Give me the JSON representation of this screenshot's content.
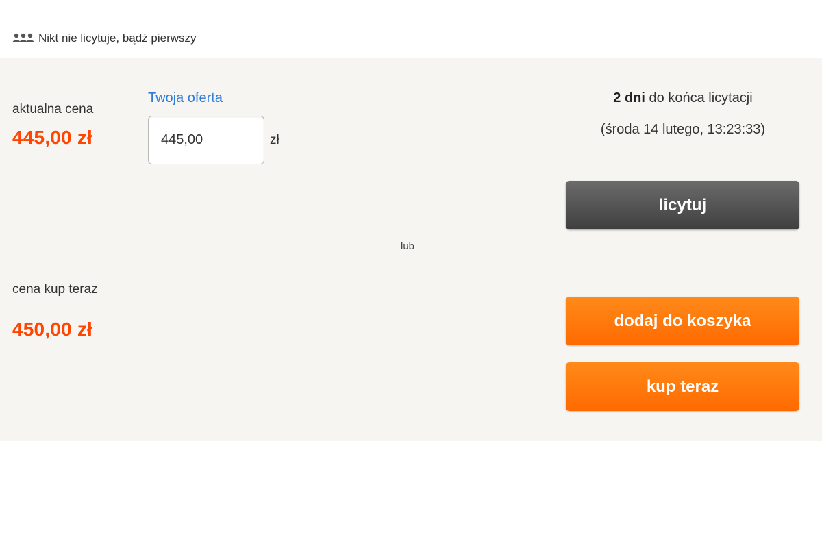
{
  "bidders": {
    "text": "Nikt nie licytuje, bądź pierwszy",
    "icon": "users-icon"
  },
  "auction": {
    "current_price_label": "aktualna cena",
    "current_price": "445,00 zł",
    "offer_label": "Twoja oferta",
    "offer_value": "445,00",
    "currency": "zł",
    "countdown_bold": "2 dni",
    "countdown_rest": "do końca licytacji",
    "end_date": "(środa 14 lutego, 13:23:33)",
    "bid_button": "licytuj"
  },
  "divider_text": "lub",
  "buy_now": {
    "price_label": "cena kup teraz",
    "price": "450,00 zł",
    "add_to_cart_button": "dodaj do koszyka",
    "buy_now_button": "kup teraz"
  },
  "colors": {
    "price": "#ff4500",
    "link_blue": "#2f7bd6",
    "orange_button": "#ff7a00",
    "gray_button": "#555555",
    "panel_bg": "#f6f5f2"
  }
}
